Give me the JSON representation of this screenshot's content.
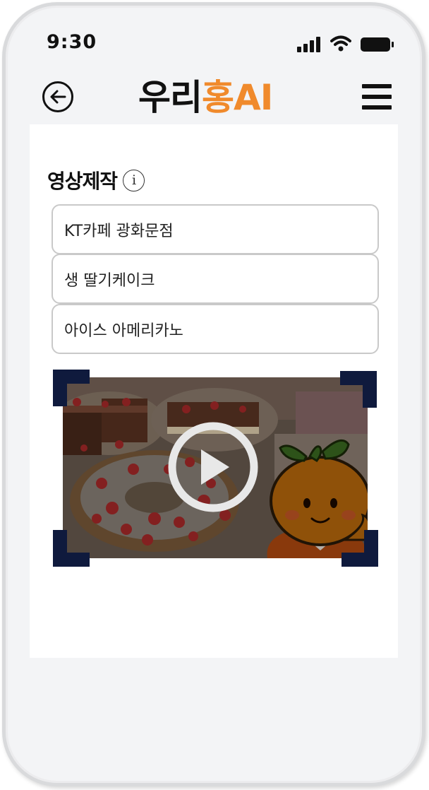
{
  "status_bar": {
    "time": "9:30"
  },
  "header": {
    "logo_part1": "우리",
    "logo_part2": "홍AI",
    "logo_accent_color": "#f08a2c",
    "back_icon": "arrow-left-circle-icon",
    "menu_icon": "hamburger-menu-icon"
  },
  "content": {
    "section_title": "영상제작",
    "info_icon": "info-icon",
    "fields": [
      {
        "value": "KT카페 광화문점"
      },
      {
        "value": "생 딸기케이크"
      },
      {
        "value": "아이스 아메리카노"
      }
    ],
    "video": {
      "thumbnail": "strawberry-cakes-with-orange-mascot",
      "play_icon": "play-circle-icon",
      "frame_color": "#0f1a3d"
    }
  }
}
